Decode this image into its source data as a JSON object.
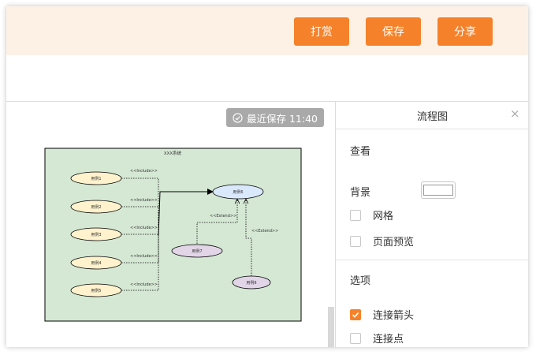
{
  "topbar": {
    "buttons": [
      {
        "label": "打赏"
      },
      {
        "label": "保存"
      },
      {
        "label": "分享"
      }
    ],
    "accent_color": "#f5822a",
    "background_color": "#fdf1e6"
  },
  "canvas": {
    "save_status": "最近保存 11:40",
    "diagram": {
      "title": "XXX系统",
      "background_color": "#d5e8d4",
      "use_cases_left": [
        "用例1",
        "用例2",
        "用例3",
        "用例4",
        "用例5"
      ],
      "target_use_case": "用例6",
      "extend_use_cases": [
        "用例7",
        "用例8"
      ],
      "include_label": "<<Include>>",
      "extend_label": "<<Extend>>"
    }
  },
  "panel": {
    "title": "流程图",
    "view_section": {
      "title": "查看",
      "background_label": "背景",
      "background_color": "#ffffff",
      "grid_label": "网格",
      "grid_checked": false,
      "page_preview_label": "页面预览",
      "page_preview_checked": false
    },
    "options_section": {
      "title": "选项",
      "connect_arrows_label": "连接箭头",
      "connect_arrows_checked": true,
      "connect_points_label": "连接点",
      "connect_points_checked": false
    }
  }
}
